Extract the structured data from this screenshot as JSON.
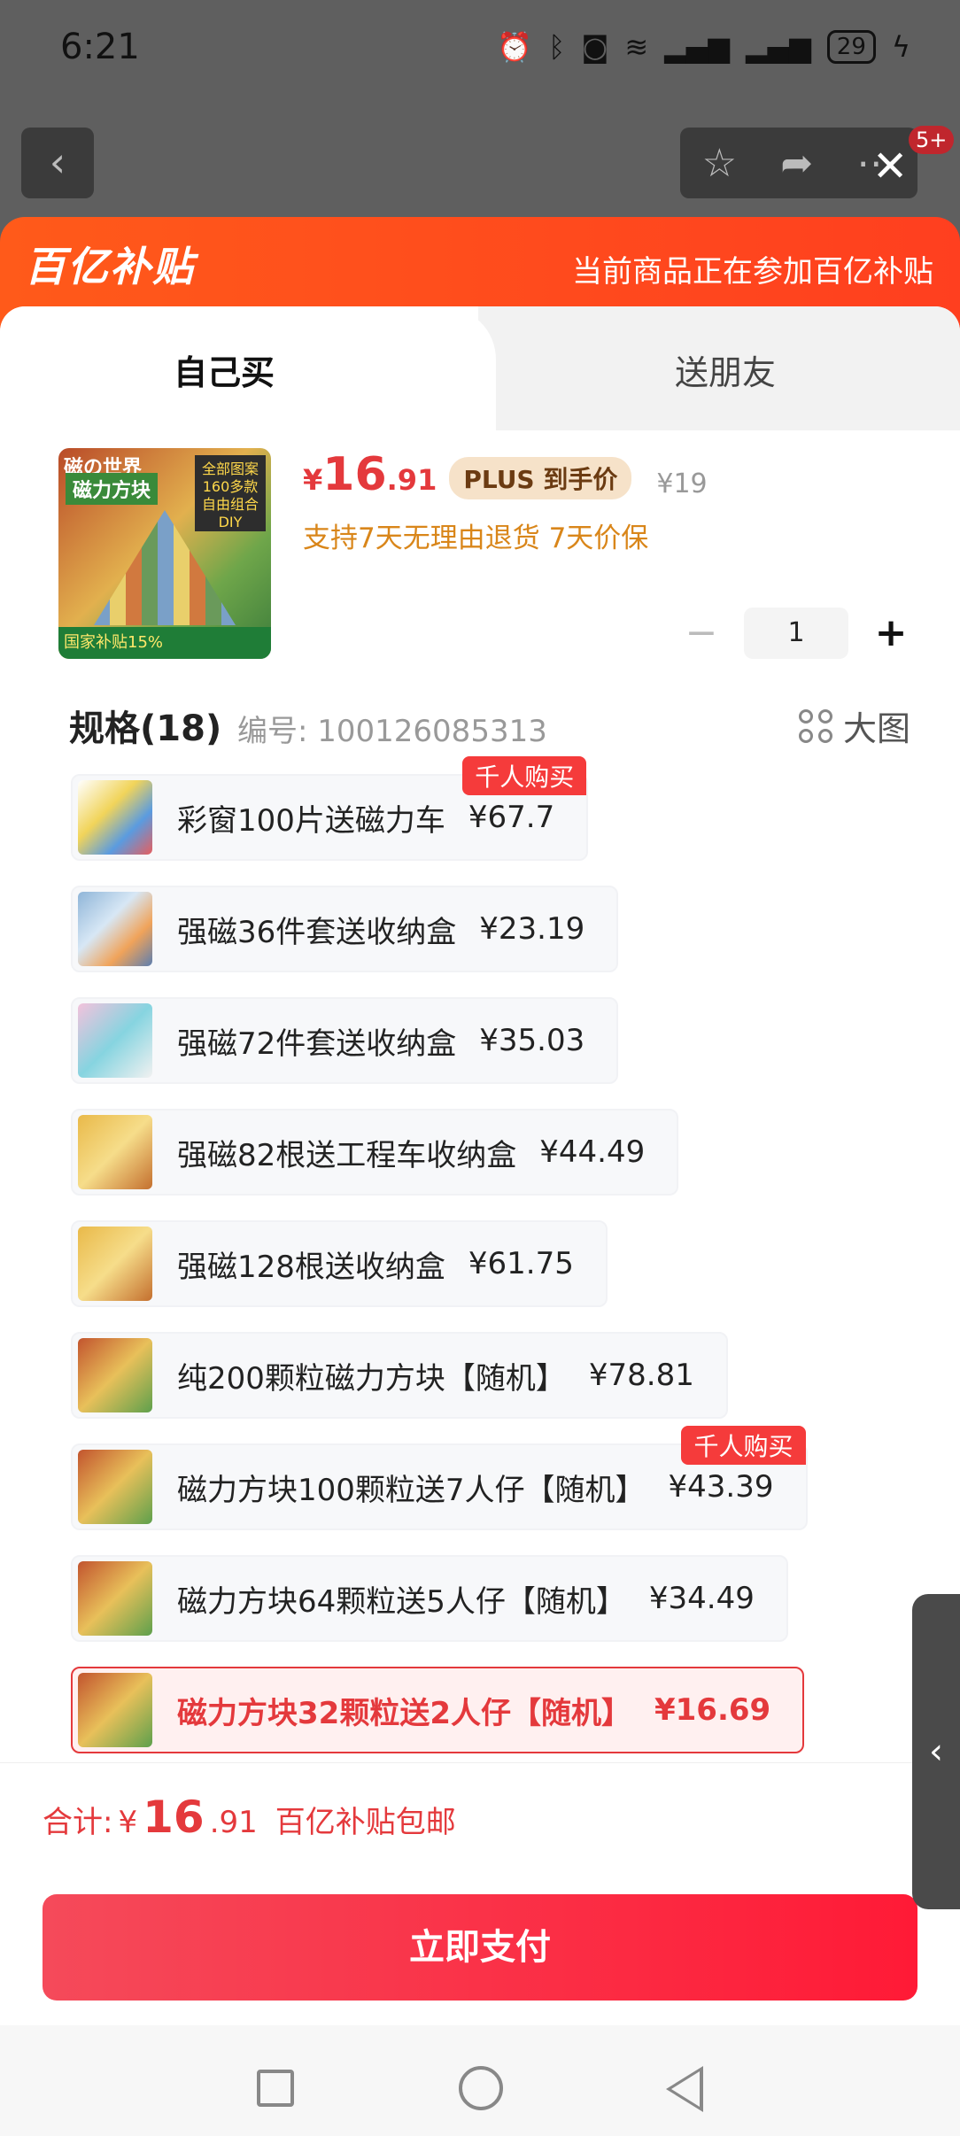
{
  "status_bar": {
    "time": "6:21",
    "battery": "29",
    "icons": [
      "alarm-icon",
      "bluetooth-icon",
      "camera-icon",
      "wifi-icon",
      "signal-icon",
      "signal-icon",
      "charging-icon"
    ]
  },
  "background": {
    "badge": "5+"
  },
  "banner": {
    "logo": "百亿补贴",
    "note": "当前商品正在参加百亿补贴"
  },
  "tabs": [
    {
      "label": "自己买"
    },
    {
      "label": "送朋友"
    }
  ],
  "product": {
    "image_title": "磁の世界",
    "image_sub": "磁力方块",
    "image_box": "全部图案 160多款 自由组合DIY",
    "image_strip": "国家补贴15%",
    "price_symbol": "¥",
    "price_int": "16",
    "price_dec": ".91",
    "plus_tag": "PLUS 到手价",
    "orig_price": "¥19",
    "guarantee": "支持7天无理由退货  7天价保",
    "quantity": "1"
  },
  "spec": {
    "title": "规格(18)",
    "code": "编号: 100126085313",
    "big_label": "大图",
    "items": [
      {
        "name": "彩窗100片送磁力车",
        "price": "¥67.7",
        "tag": "千人购买"
      },
      {
        "name": "强磁36件套送收纳盒",
        "price": "¥23.19",
        "tag": ""
      },
      {
        "name": "强磁72件套送收纳盒",
        "price": "¥35.03",
        "tag": ""
      },
      {
        "name": "强磁82根送工程车收纳盒",
        "price": "¥44.49",
        "tag": ""
      },
      {
        "name": "强磁128根送收纳盒",
        "price": "¥61.75",
        "tag": ""
      },
      {
        "name": "纯200颗粒磁力方块【随机】",
        "price": "¥78.81",
        "tag": ""
      },
      {
        "name": "磁力方块100颗粒送7人仔【随机】",
        "price": "¥43.39",
        "tag": "千人购买"
      },
      {
        "name": "磁力方块64颗粒送5人仔【随机】",
        "price": "¥34.49",
        "tag": ""
      },
      {
        "name": "磁力方块32颗粒送2人仔【随机】",
        "price": "¥16.69",
        "tag": ""
      }
    ],
    "selected_index": 8
  },
  "footer": {
    "total_label": "合计:",
    "total_symbol": "¥",
    "total_int": "16",
    "total_dec": ".91",
    "total_note": "百亿补贴包邮",
    "pay_label": "立即支付"
  },
  "colors": {
    "accent": "#e4393c",
    "banner": "#ff4f1c",
    "pay": "#ff1a36"
  }
}
